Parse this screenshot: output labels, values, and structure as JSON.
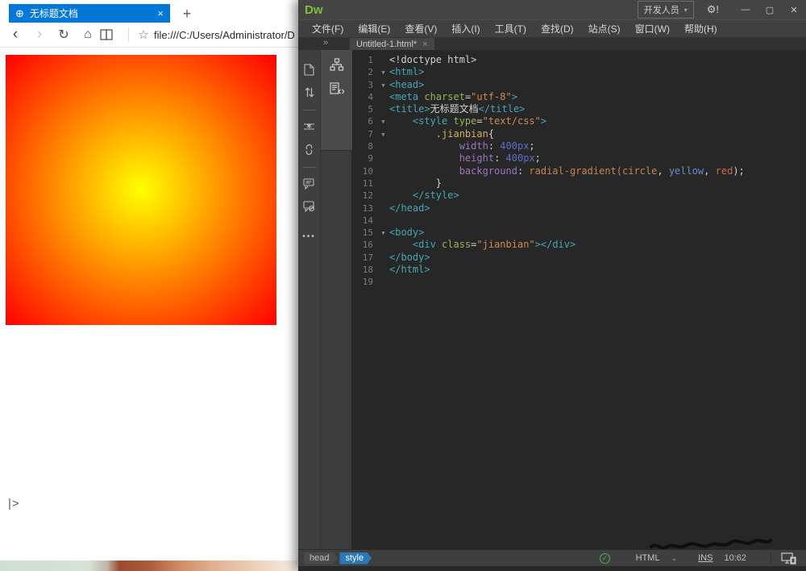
{
  "browser": {
    "tab": {
      "title": "无标题文档",
      "globe_glyph": "⊕",
      "close_glyph": "×"
    },
    "new_tab_glyph": "+",
    "toolbar": {
      "back_glyph": "‹",
      "forward_glyph": "›",
      "refresh_glyph": "↻",
      "home_glyph": "⌂",
      "favorite_glyph": "☆",
      "url": "file:///C:/Users/Administrator/D"
    },
    "sidebar_expand_glyph": "|>",
    "page": {
      "gradient_inner_color": "#ffff00",
      "gradient_outer_color": "#ff0000",
      "gradient_shape": "circle"
    }
  },
  "dreamweaver": {
    "logo": "Dw",
    "titlebar": {
      "workspace_label": "开发人员",
      "workspace_caret": "▾",
      "sync_glyph": "⚙!",
      "minimize_glyph": "—",
      "maximize_glyph": "▢",
      "close_glyph": "✕"
    },
    "menus": [
      "文件(F)",
      "编辑(E)",
      "查看(V)",
      "插入(I)",
      "工具(T)",
      "查找(D)",
      "站点(S)",
      "窗口(W)",
      "帮助(H)"
    ],
    "dock_chevron": "»",
    "doc_tab": {
      "label": "Untitled-1.html*",
      "close_glyph": "×"
    },
    "toolbar_icon_names": [
      "open-documents-icon",
      "file-management-icon",
      "format-icon",
      "unlink-icon",
      "comment-icon",
      "remove-comment-icon",
      "toolbar-more-dots"
    ],
    "toolbar_more_glyph": "•••",
    "dock_icon_names": [
      "dom-panel-icon",
      "snippets-panel-icon"
    ],
    "code": {
      "lines": [
        {
          "n": 1,
          "fold": false,
          "tokens": [
            [
              "w",
              "<!doctype html>"
            ]
          ]
        },
        {
          "n": 2,
          "fold": true,
          "tokens": [
            [
              "t",
              "<html>"
            ]
          ]
        },
        {
          "n": 3,
          "fold": true,
          "tokens": [
            [
              "t",
              "<head>"
            ]
          ]
        },
        {
          "n": 4,
          "fold": false,
          "tokens": [
            [
              "t",
              "<meta "
            ],
            [
              "a",
              "charset"
            ],
            [
              "w",
              "="
            ],
            [
              "s",
              "\"utf-8\""
            ],
            [
              "t",
              ">"
            ]
          ]
        },
        {
          "n": 5,
          "fold": false,
          "tokens": [
            [
              "t",
              "<title>"
            ],
            [
              "w",
              "无标题文档"
            ],
            [
              "t",
              "</title>"
            ]
          ]
        },
        {
          "n": 6,
          "fold": true,
          "tokens": [
            [
              "w",
              "    "
            ],
            [
              "t",
              "<style "
            ],
            [
              "a",
              "type"
            ],
            [
              "w",
              "="
            ],
            [
              "s",
              "\"text/css\""
            ],
            [
              "t",
              ">"
            ]
          ]
        },
        {
          "n": 7,
          "fold": true,
          "tokens": [
            [
              "w",
              "        "
            ],
            [
              "sel",
              ".jianbian"
            ],
            [
              "w",
              "{"
            ]
          ]
        },
        {
          "n": 8,
          "fold": false,
          "tokens": [
            [
              "w",
              "            "
            ],
            [
              "p",
              "width"
            ],
            [
              "w",
              ": "
            ],
            [
              "n",
              "400px"
            ],
            [
              "w",
              ";"
            ]
          ]
        },
        {
          "n": 9,
          "fold": false,
          "tokens": [
            [
              "w",
              "            "
            ],
            [
              "p",
              "height"
            ],
            [
              "w",
              ": "
            ],
            [
              "n",
              "400px"
            ],
            [
              "w",
              ";"
            ]
          ]
        },
        {
          "n": 10,
          "fold": false,
          "tokens": [
            [
              "w",
              "            "
            ],
            [
              "p",
              "background"
            ],
            [
              "w",
              ": "
            ],
            [
              "f",
              "radial-gradient(circle"
            ],
            [
              "w",
              ", "
            ],
            [
              "kb",
              "yellow"
            ],
            [
              "w",
              ", "
            ],
            [
              "r",
              "red"
            ],
            [
              "w",
              ");"
            ]
          ]
        },
        {
          "n": 11,
          "fold": false,
          "tokens": [
            [
              "w",
              "        }"
            ]
          ]
        },
        {
          "n": 12,
          "fold": false,
          "tokens": [
            [
              "w",
              "    "
            ],
            [
              "t",
              "</style>"
            ]
          ]
        },
        {
          "n": 13,
          "fold": false,
          "tokens": [
            [
              "t",
              "</head>"
            ]
          ]
        },
        {
          "n": 14,
          "fold": false,
          "tokens": []
        },
        {
          "n": 15,
          "fold": true,
          "tokens": [
            [
              "t",
              "<body>"
            ]
          ]
        },
        {
          "n": 16,
          "fold": false,
          "tokens": [
            [
              "w",
              "    "
            ],
            [
              "t",
              "<div "
            ],
            [
              "a",
              "class"
            ],
            [
              "w",
              "="
            ],
            [
              "s",
              "\"jianbian\""
            ],
            [
              "t",
              "></div>"
            ]
          ]
        },
        {
          "n": 17,
          "fold": false,
          "tokens": [
            [
              "t",
              "</body>"
            ]
          ]
        },
        {
          "n": 18,
          "fold": false,
          "tokens": [
            [
              "t",
              "</html>"
            ]
          ]
        },
        {
          "n": 19,
          "fold": false,
          "tokens": []
        }
      ]
    },
    "statusbar": {
      "tag_path": [
        "head",
        "style"
      ],
      "lint_glyph": "✓",
      "doc_type": "HTML",
      "doc_type_caret": "⌄",
      "ins_label": "INS",
      "cursor_position": "10:62"
    },
    "syntax_colors": {
      "tag": "#46a6b2",
      "attr_name": "#93b35b",
      "attr_value": "#cf8a50",
      "selector": "#cdb35f",
      "property": "#9b74c6",
      "number": "#5c6fc5",
      "keyword": "#6e87d2",
      "function": "#c8854f",
      "plain": "#d0d0d0"
    },
    "accent_colors": {
      "edge_blue": "#0078d7",
      "dw_green": "#7ac142",
      "status_tag_blue": "#2b77b8",
      "lint_green": "#4caf50"
    }
  }
}
